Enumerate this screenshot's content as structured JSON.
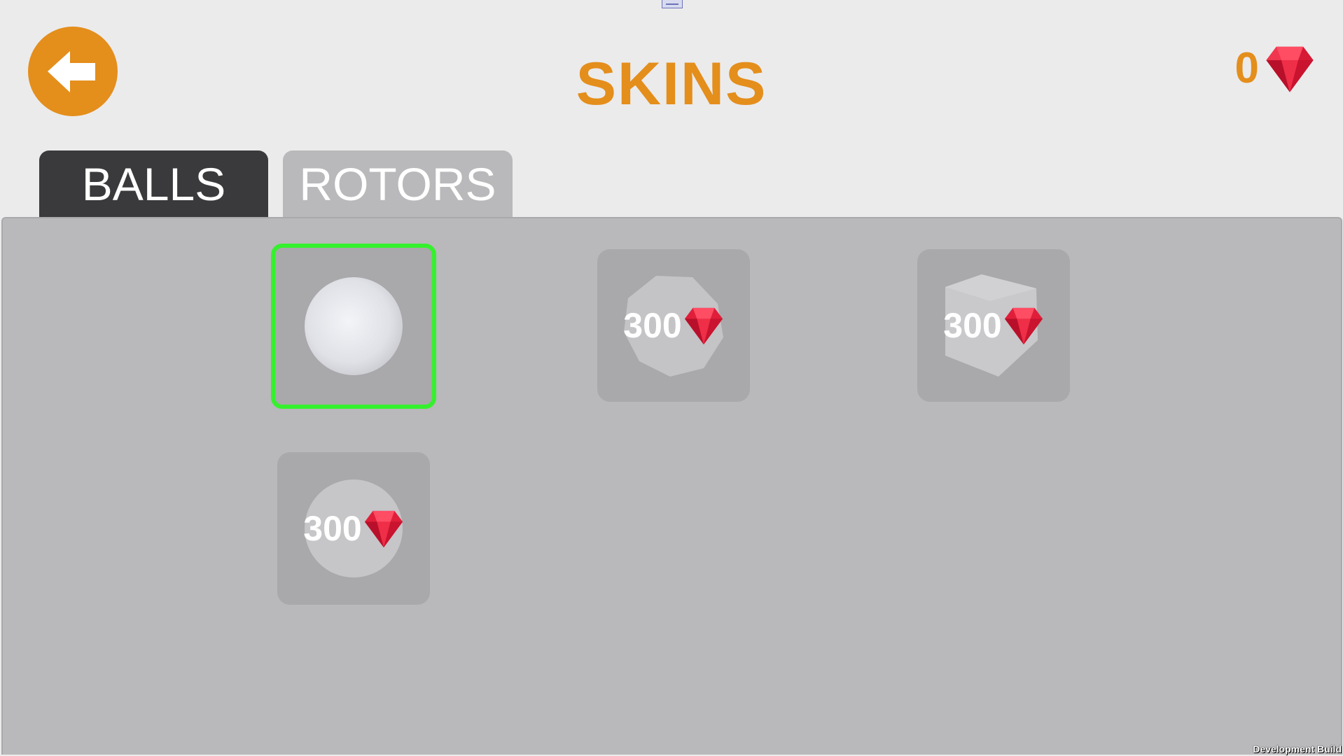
{
  "header": {
    "title": "SKINS",
    "gem_count": "0",
    "back_icon": "back-arrow-icon",
    "currency_icon": "red-gem-icon"
  },
  "tabs": [
    {
      "label": "BALLS",
      "active": true
    },
    {
      "label": "ROTORS",
      "active": false
    }
  ],
  "skins": [
    {
      "shape": "sphere",
      "selected": true,
      "owned": true
    },
    {
      "shape": "polygon",
      "selected": false,
      "owned": false,
      "price": "300"
    },
    {
      "shape": "cube",
      "selected": false,
      "owned": false,
      "price": "300"
    },
    {
      "shape": "sphere",
      "selected": false,
      "owned": false,
      "price": "300"
    }
  ],
  "footer": {
    "build_label": "Development Build"
  },
  "colors": {
    "accent": "#e48e1c",
    "selection": "#35f12d",
    "gem": "#e01e3a",
    "active_tab": "#3a3a3d",
    "panel": "#b9b8ba"
  }
}
